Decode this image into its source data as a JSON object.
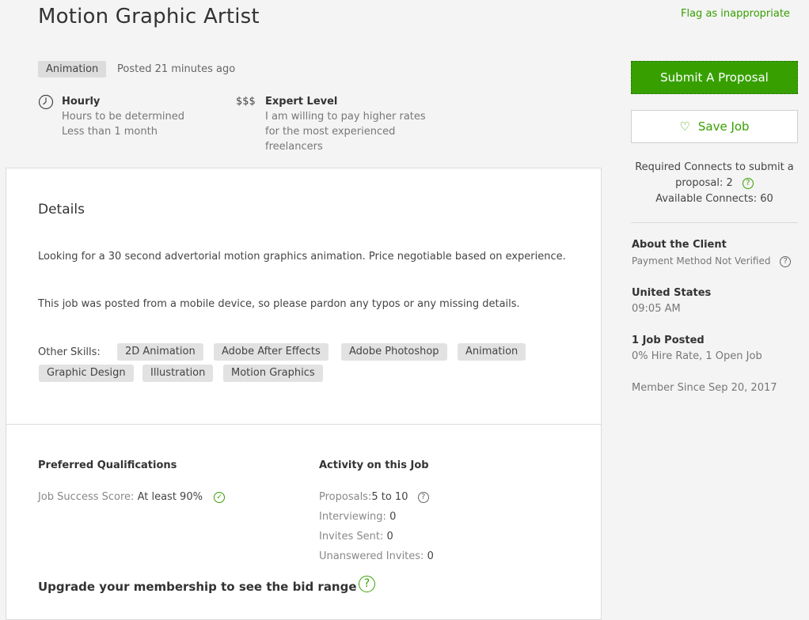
{
  "job": {
    "title": "Motion Graphic Artist",
    "flag_link": "Flag as inappropriate",
    "category": "Animation",
    "posted": "Posted 21 minutes ago",
    "type": {
      "icon": "clock-icon",
      "title": "Hourly",
      "line1": "Hours to be determined",
      "line2": "Less than 1 month"
    },
    "level": {
      "symbol": "$$$",
      "title": "Expert Level",
      "line1": "I am willing to pay higher rates",
      "line2": "for the most experienced",
      "line3": "freelancers"
    }
  },
  "details": {
    "heading": "Details",
    "paragraph1": "Looking for a 30 second advertorial motion graphics animation. Price negotiable based on experience.",
    "paragraph2": "This job was posted from a mobile device, so please pardon any typos or any missing details.",
    "skills_label": "Other Skills:",
    "skills": [
      "2D Animation",
      "Adobe After Effects",
      "Adobe Photoshop",
      "Animation",
      "Graphic Design",
      "Illustration",
      "Motion Graphics"
    ]
  },
  "qualifications": {
    "heading": "Preferred Qualifications",
    "job_success_label": "Job Success Score:",
    "job_success_value": "At least 90%"
  },
  "activity": {
    "heading": "Activity on this Job",
    "proposals_label": "Proposals:",
    "proposals_value": "5 to 10",
    "interviewing_label": "Interviewing:",
    "interviewing_value": "0",
    "invites_label": "Invites Sent:",
    "invites_value": "0",
    "unanswered_label": "Unanswered Invites:",
    "unanswered_value": "0"
  },
  "upgrade": {
    "text": "Upgrade your membership to see the bid range",
    "help_glyph": "?"
  },
  "sidebar": {
    "submit_label": "Submit A Proposal",
    "save_label": "Save Job",
    "connects_line1": "Required Connects to submit a",
    "connects_line2": "proposal: 2",
    "connects_line3": "Available Connects: 60",
    "about_heading": "About the Client",
    "payment_status": "Payment Method Not Verified",
    "country": "United States",
    "local_time": "09:05 AM",
    "jobs_posted": "1 Job Posted",
    "hire_rate": "0% Hire Rate, 1 Open Job",
    "member_since": "Member Since Sep 20, 2017"
  },
  "colors": {
    "accent": "#37a000",
    "background": "#f4f4f4",
    "card": "#ffffff",
    "chip": "#e2e2e2"
  }
}
